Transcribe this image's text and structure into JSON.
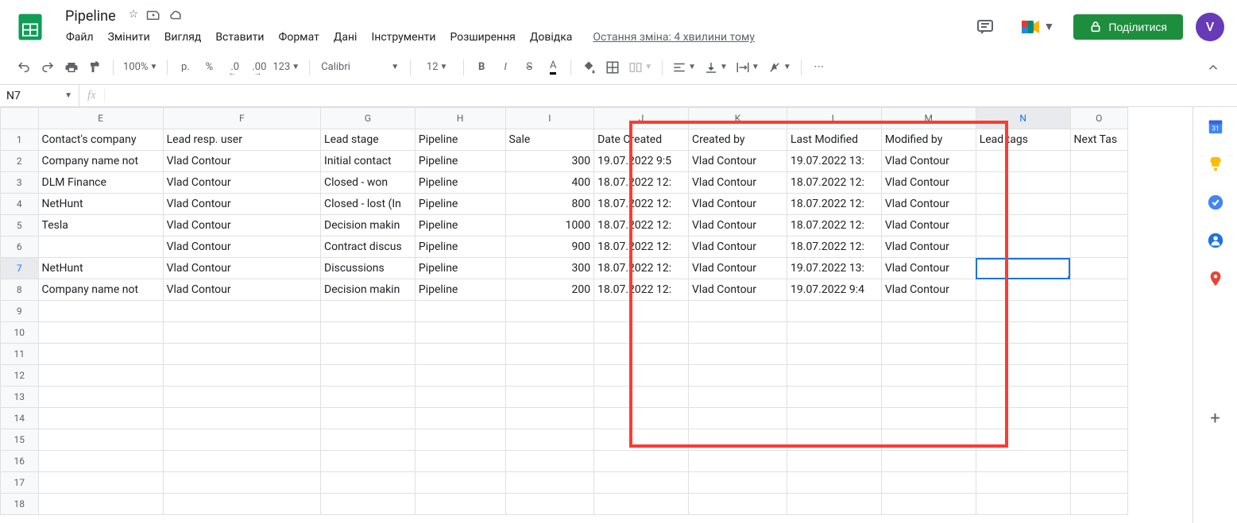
{
  "doc": {
    "title": "Pipeline"
  },
  "menu": {
    "file": "Файл",
    "edit": "Змінити",
    "view": "Вигляд",
    "insert": "Вставити",
    "format": "Формат",
    "data": "Дані",
    "tools": "Інструменти",
    "extensions": "Розширення",
    "help": "Довідка",
    "last_change": "Остання зміна: 4 хвилини тому"
  },
  "share": {
    "label": "Поділитися"
  },
  "avatar": {
    "initial": "V"
  },
  "toolbar": {
    "zoom": "100%",
    "currency": "р.",
    "percent": "%",
    "dec_dec": ".0",
    "dec_inc": ".00",
    "num_format": "123",
    "font": "Calibri",
    "size": "12"
  },
  "namebox": {
    "value": "N7"
  },
  "fx": {
    "label": "fx"
  },
  "columns": [
    "E",
    "F",
    "G",
    "H",
    "I",
    "J",
    "K",
    "L",
    "M",
    "N",
    "O"
  ],
  "headers": {
    "E": "Contact's company",
    "F": "Lead resp. user",
    "G": "Lead stage",
    "H": "Pipeline",
    "I": "Sale",
    "J": "Date Created",
    "K": "Created by",
    "L": "Last Modified",
    "M": "Modified by",
    "N": "Lead tags",
    "O": "Next Tas"
  },
  "rows": [
    {
      "E": "Company name not",
      "F": "Vlad Contour",
      "G": "Initial contact",
      "H": "Pipeline",
      "I": "300",
      "J": "19.07.2022 9:5",
      "K": "Vlad Contour",
      "L": "19.07.2022 13:",
      "M": "Vlad Contour"
    },
    {
      "E": "DLM Finance",
      "F": "Vlad Contour",
      "G": "Closed - won",
      "H": "Pipeline",
      "I": "400",
      "J": "18.07.2022 12:",
      "K": "Vlad Contour",
      "L": "18.07.2022 12:",
      "M": "Vlad Contour"
    },
    {
      "E": "NetHunt",
      "F": "Vlad Contour",
      "G": "Closed - lost (In",
      "H": "Pipeline",
      "I": "800",
      "J": "18.07.2022 12:",
      "K": "Vlad Contour",
      "L": "18.07.2022 12:",
      "M": "Vlad Contour"
    },
    {
      "E": "Tesla",
      "F": "Vlad Contour",
      "G": "Decision makin",
      "H": "Pipeline",
      "I": "1000",
      "J": "18.07.2022 12:",
      "K": "Vlad Contour",
      "L": "18.07.2022 12:",
      "M": "Vlad Contour"
    },
    {
      "E": "",
      "F": "Vlad Contour",
      "G": "Contract discus",
      "H": "Pipeline",
      "I": "900",
      "J": "18.07.2022 12:",
      "K": "Vlad Contour",
      "L": "18.07.2022 12:",
      "M": "Vlad Contour"
    },
    {
      "E": "NetHunt",
      "F": "Vlad Contour",
      "G": "Discussions",
      "H": "Pipeline",
      "I": "300",
      "J": "18.07.2022 12:",
      "K": "Vlad Contour",
      "L": "19.07.2022 13:",
      "M": "Vlad Contour"
    },
    {
      "E": "Company name not",
      "F": "Vlad Contour",
      "G": "Decision makin",
      "H": "Pipeline",
      "I": "200",
      "J": "18.07.2022 12:",
      "K": "Vlad Contour",
      "L": "19.07.2022 9:4",
      "M": "Vlad Contour"
    }
  ],
  "selected": {
    "col": "N",
    "row": 7
  }
}
